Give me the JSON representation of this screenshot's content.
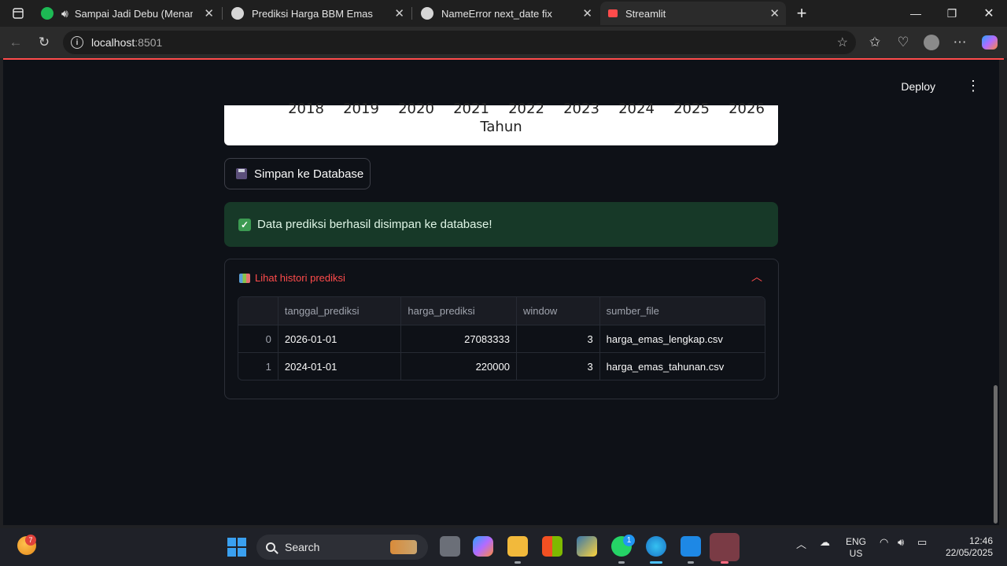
{
  "browser": {
    "tabs": [
      {
        "title": "Sampai Jadi Debu (Menampi",
        "favicon_color": "#1db954",
        "icon": "spotify-icon",
        "audio": true
      },
      {
        "title": "Prediksi Harga BBM Emas",
        "favicon_color": "#d6d6d6",
        "icon": "chatgpt-icon"
      },
      {
        "title": "NameError next_date fix",
        "favicon_color": "#d6d6d6",
        "icon": "chatgpt-icon"
      },
      {
        "title": "Streamlit",
        "favicon_color": "#ff4b4b",
        "icon": "streamlit-icon"
      }
    ],
    "address": {
      "host": "localhost",
      "port": ":8501"
    }
  },
  "app": {
    "deploy_label": "Deploy",
    "chart": {
      "x_ticks": [
        "2018",
        "2019",
        "2020",
        "2021",
        "2022",
        "2023",
        "2024",
        "2025",
        "2026"
      ],
      "xlabel": "Tahun"
    },
    "save_button_label": "Simpan ke Database",
    "success_message": "Data prediksi berhasil disimpan ke database!",
    "expander_label": "Lihat histori prediksi",
    "table": {
      "columns": [
        "",
        "tanggal_prediksi",
        "harga_prediksi",
        "window",
        "sumber_file"
      ],
      "rows": [
        [
          "0",
          "2026-01-01",
          "27083333",
          "3",
          "harga_emas_lengkap.csv"
        ],
        [
          "1",
          "2024-01-01",
          "220000",
          "3",
          "harga_emas_tahunan.csv"
        ]
      ]
    }
  },
  "taskbar": {
    "weather_badge": "7",
    "search_placeholder": "Search",
    "whatsapp_badge": "1",
    "lang_line1": "ENG",
    "lang_line2": "US",
    "time": "12:46",
    "date": "22/05/2025"
  },
  "colors": {
    "accent": "#ff4b4b",
    "page_bg": "#0e1117",
    "success_bg": "#173928"
  }
}
